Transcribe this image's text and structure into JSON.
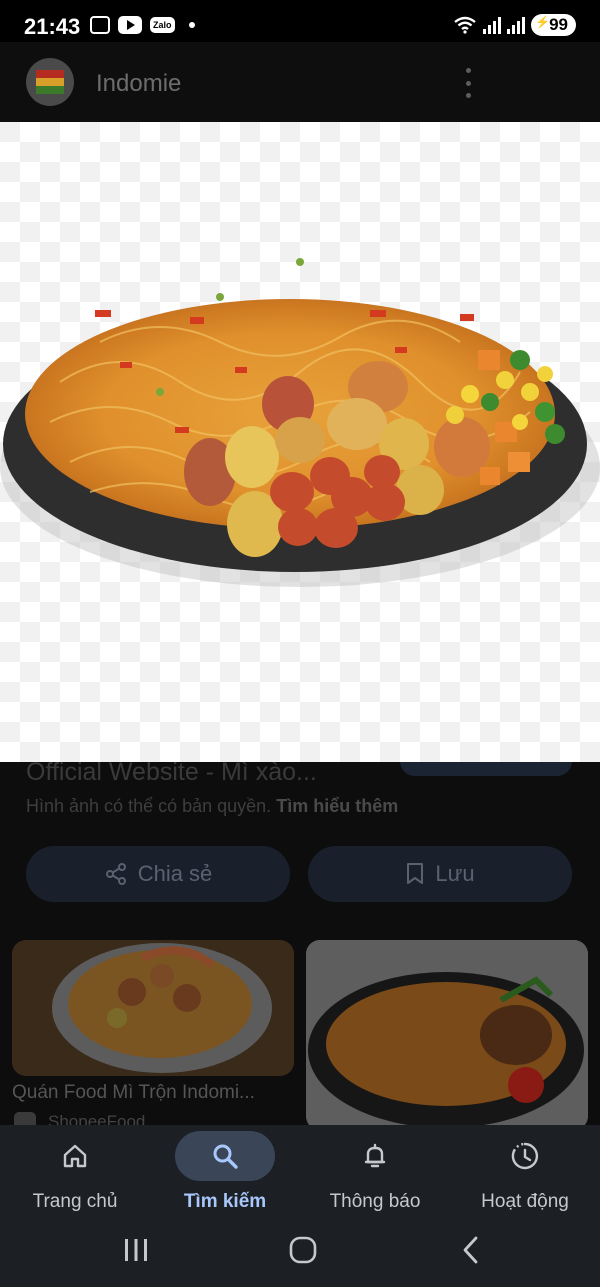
{
  "status_bar": {
    "time": "21:43",
    "zalo_label": "Zalo",
    "battery": "99"
  },
  "app_header": {
    "title": "Indomie"
  },
  "result": {
    "title": "Official Website - Mì xào...",
    "copyright_text": "Hình ảnh có thể có bản quyền.",
    "learn_more": "Tìm hiểu thêm",
    "share_label": "Chia sẻ",
    "save_label": "Lưu"
  },
  "related": [
    {
      "caption": "Quán Food Mì Trộn Indomi...",
      "source": "ShopeeFood"
    },
    {
      "caption": "",
      "source": ""
    }
  ],
  "bottom_nav": {
    "items": [
      {
        "label": "Trang chủ",
        "icon": "home-icon",
        "active": false
      },
      {
        "label": "Tìm kiếm",
        "icon": "search-icon",
        "active": true
      },
      {
        "label": "Thông báo",
        "icon": "bell-icon",
        "active": false
      },
      {
        "label": "Hoạt động",
        "icon": "activity-icon",
        "active": false
      }
    ]
  },
  "system_nav": {
    "icons": [
      "recents-icon",
      "home-button-icon",
      "back-icon"
    ]
  },
  "colors": {
    "active_nav_text": "#a8c7fa",
    "active_nav_bg": "#3a4657",
    "nav_bg": "#1c1f24"
  }
}
